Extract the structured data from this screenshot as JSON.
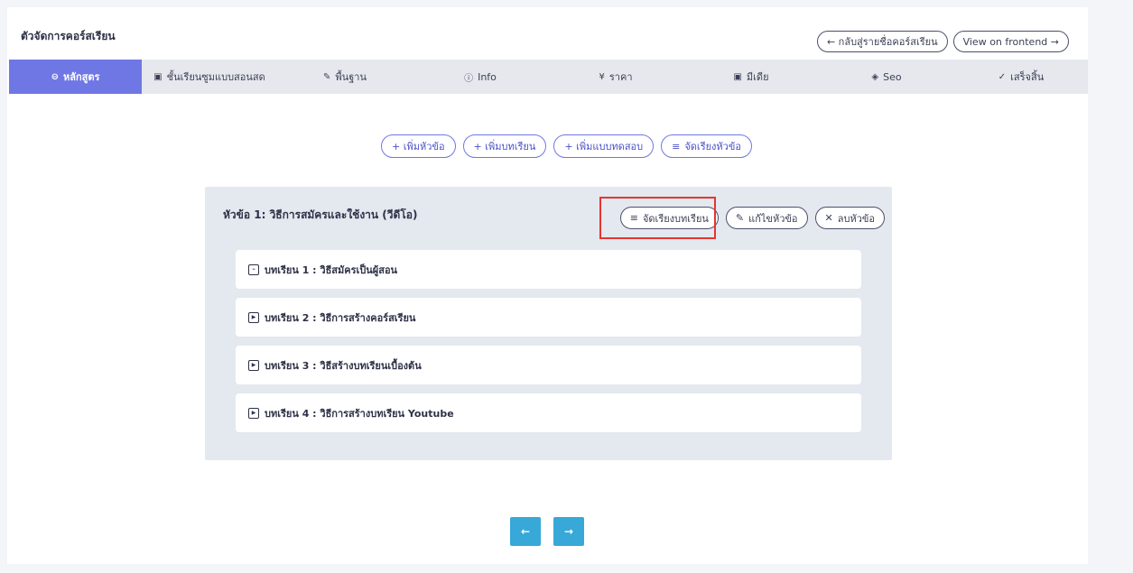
{
  "page_title": "ตัวจัดการคอร์สเรียน",
  "header_actions": {
    "back_label": "← กลับสู่รายชื่อคอร์สเรียน",
    "frontend_label": "View on frontend →"
  },
  "tabs": [
    {
      "icon": "user-circle-icon",
      "glyph": "⊖",
      "label": "หลักสูตร",
      "active": true
    },
    {
      "icon": "live-class-icon",
      "glyph": "▣",
      "label": "ชั้นเรียนซูมแบบสอนสด",
      "active": false
    },
    {
      "icon": "pencil-icon",
      "glyph": "✎",
      "label": "พื้นฐาน",
      "active": false
    },
    {
      "icon": "info-icon",
      "glyph": "ⓘ",
      "label": "Info",
      "active": false
    },
    {
      "icon": "yen-icon",
      "glyph": "¥",
      "label": "ราคา",
      "active": false
    },
    {
      "icon": "media-icon",
      "glyph": "▣",
      "label": "มีเดีย",
      "active": false
    },
    {
      "icon": "tag-icon",
      "glyph": "◈",
      "label": "Seo",
      "active": false
    },
    {
      "icon": "check-circle-icon",
      "glyph": "✓",
      "label": "เสร็จสิ้น",
      "active": false
    }
  ],
  "actions": {
    "add_section": "+ เพิ่มหัวข้อ",
    "add_lesson": "+ เพิ่มบทเรียน",
    "add_quiz": "+ เพิ่มแบบทดสอบ",
    "sort_sections": "จัดเรียงหัวข้อ"
  },
  "section": {
    "title": "หัวข้อ 1: วิธีการสมัครและใช้งาน (วีดีโอ)",
    "sort_lessons": "จัดเรียงบทเรียน",
    "edit": "แก้ไขหัวข้อ",
    "delete": "ลบหัวข้อ",
    "lessons": [
      {
        "icon": "pdf-icon",
        "title": "บทเรียน 1 : วิธีสมัครเป็นผู้สอน"
      },
      {
        "icon": "video-icon",
        "title": "บทเรียน 2 : วิธีการสร้างคอร์สเรียน"
      },
      {
        "icon": "video-icon",
        "title": "บทเรียน 3 : วิธีสร้างบทเรียนเบื้องต้น"
      },
      {
        "icon": "video-icon",
        "title": "บทเรียน 4 : วิธีการสร้างบทเรียน Youtube"
      }
    ]
  },
  "nav": {
    "prev": "←",
    "next": "→"
  },
  "colors": {
    "accent": "#6f77e4",
    "nav_button": "#37a8d8",
    "highlight": "#e53530"
  }
}
